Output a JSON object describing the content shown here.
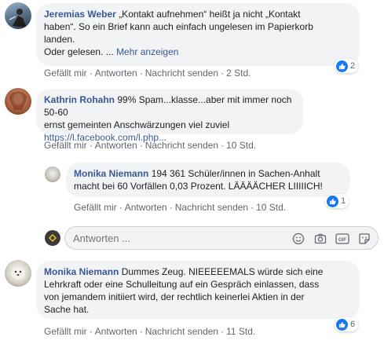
{
  "comments": [
    {
      "author": "Jeremias Weber",
      "lines": [
        "„Kontakt aufnehmen“ heißt ja nicht „Kontakt",
        "haben“. So ein Brief kann auch einfach ungelesen im Papierkorb",
        "landen.",
        "Oder gelesen. ..."
      ],
      "more": "Mehr anzeigen",
      "reactions": "2",
      "actions": {
        "like": "Gefällt mir",
        "reply": "Antworten",
        "message": "Nachricht senden",
        "time": "2 Std."
      }
    },
    {
      "author": "Kathrin Rohahn",
      "lines": [
        "99% Spam...klasse...aber mit immer noch 50-60",
        "ernst gemeinten Anschwärzungen viel zuviel"
      ],
      "link": "https://l.facebook.com/l.php...",
      "actions": {
        "like": "Gefällt mir",
        "reply": "Antworten",
        "message": "Nachricht senden",
        "time": "10 Std."
      }
    },
    {
      "author": "Monika Niemann",
      "lines": [
        "194 361 Schüler/innen in Sachen-Anhalt",
        "macht bei 60 Vorfällen 0,03 Prozent. LÄÄÄÄCHER LIIIIICH!"
      ],
      "reactions": "1",
      "actions": {
        "like": "Gefällt mir",
        "reply": "Antworten",
        "message": "Nachricht senden",
        "time": "10 Std."
      }
    },
    {
      "author": "Monika Niemann",
      "lines": [
        "Dummes Zeug. NIEEEEEMALS würde sich eine",
        "Lehrkraft oder eine Schulleitung auf ein Gespräch einlassen, dass",
        "von jemandem initiiert wird, der rechtlich keinerlei Aktien in der",
        "Sache hat."
      ],
      "reactions": "6",
      "actions": {
        "like": "Gefällt mir",
        "reply": "Antworten",
        "message": "Nachricht senden",
        "time": "11 Std."
      }
    }
  ],
  "reply_box": {
    "placeholder": "Antworten ..."
  },
  "icons": {
    "like": "thumbs-up-icon",
    "emoji": "emoji-icon",
    "camera": "camera-icon",
    "gif": "gif-icon",
    "sticker": "sticker-icon"
  },
  "colors": {
    "author": "#385898",
    "bubble": "#f2f3f5",
    "like": "#1877f2",
    "meta": "#606770"
  }
}
